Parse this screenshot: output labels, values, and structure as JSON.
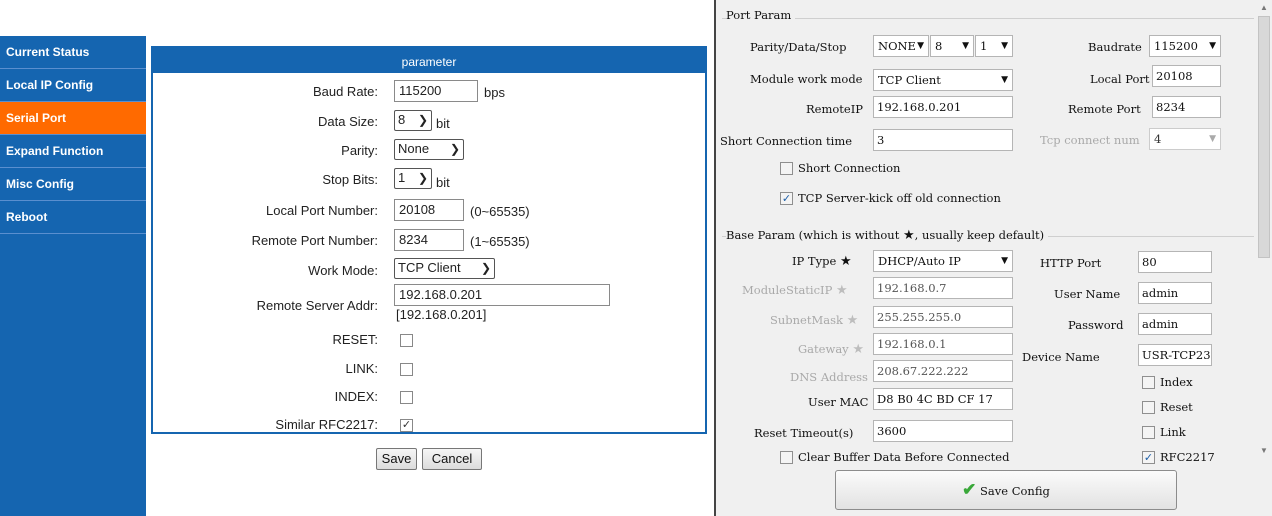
{
  "left": {
    "menu": [
      "Current Status",
      "Local IP Config",
      "Serial Port",
      "Expand Function",
      "Misc Config",
      "Reboot"
    ],
    "panel_title": "parameter",
    "labels": {
      "baud": "Baud Rate:",
      "data_size": "Data Size:",
      "parity": "Parity:",
      "stop_bits": "Stop Bits:",
      "local_port": "Local Port Number:",
      "remote_port": "Remote Port Number:",
      "work_mode": "Work Mode:",
      "remote_addr": "Remote Server Addr:",
      "reset": "RESET:",
      "link": "LINK:",
      "index": "INDEX:",
      "rfc": "Similar RFC2217:"
    },
    "values": {
      "baud": "115200",
      "data_size": "8",
      "parity": "None",
      "stop_bits": "1",
      "local_port": "20108",
      "remote_port": "8234",
      "work_mode": "TCP Client",
      "remote_addr": "192.168.0.201",
      "remote_addr_resolved": "[192.168.0.201]"
    },
    "units": {
      "bps": "bps",
      "bit": "bit",
      "bit2": "bit",
      "local_range": "(0~65535)",
      "remote_range": "(1~65535)"
    },
    "buttons": {
      "save": "Save",
      "cancel": "Cancel"
    }
  },
  "right": {
    "port_param": "Port Param",
    "labels": {
      "pds": "Parity/Data/Stop",
      "baudrate": "Baudrate",
      "work_mode": "Module work mode",
      "local_port": "Local Port",
      "remote_ip": "RemoteIP",
      "remote_port": "Remote Port",
      "short_time": "Short Connection time",
      "tcp_num": "Tcp connect num",
      "short_conn": "Short Connection",
      "kick": "TCP Server-kick off old connection"
    },
    "values": {
      "parity": "NONE",
      "data": "8",
      "stop": "1",
      "baudrate": "115200",
      "work_mode": "TCP Client",
      "local_port": "20108",
      "remote_ip": "192.168.0.201",
      "remote_port": "8234",
      "short_time": "3",
      "tcp_num": "4"
    },
    "base_param": "Base Param (which is without",
    "base_param_tail": ", usually keep default)",
    "base_labels": {
      "ip_type": "IP Type",
      "static_ip": "ModuleStaticIP",
      "mask": "SubnetMask",
      "gateway": "Gateway",
      "dns": "DNS Address",
      "mac": "User MAC",
      "reset_timeout": "Reset Timeout(s)",
      "clear_buf": "Clear Buffer Data Before Connected",
      "http_port": "HTTP Port",
      "user_name": "User Name",
      "password": "Password",
      "device_name": "Device Name",
      "index": "Index",
      "reset": "Reset",
      "link": "Link",
      "rfc": "RFC2217"
    },
    "base_values": {
      "ip_type": "DHCP/Auto IP",
      "static_ip": "192.168.0.7",
      "mask": "255.255.255.0",
      "gateway": "192.168.0.1",
      "dns": "208.67.222.222",
      "mac": "D8 B0 4C BD CF 17",
      "reset_timeout": "3600",
      "http_port": "80",
      "user_name": "admin",
      "password": "admin",
      "device_name": "USR-TCP23"
    },
    "save": "Save Config"
  }
}
